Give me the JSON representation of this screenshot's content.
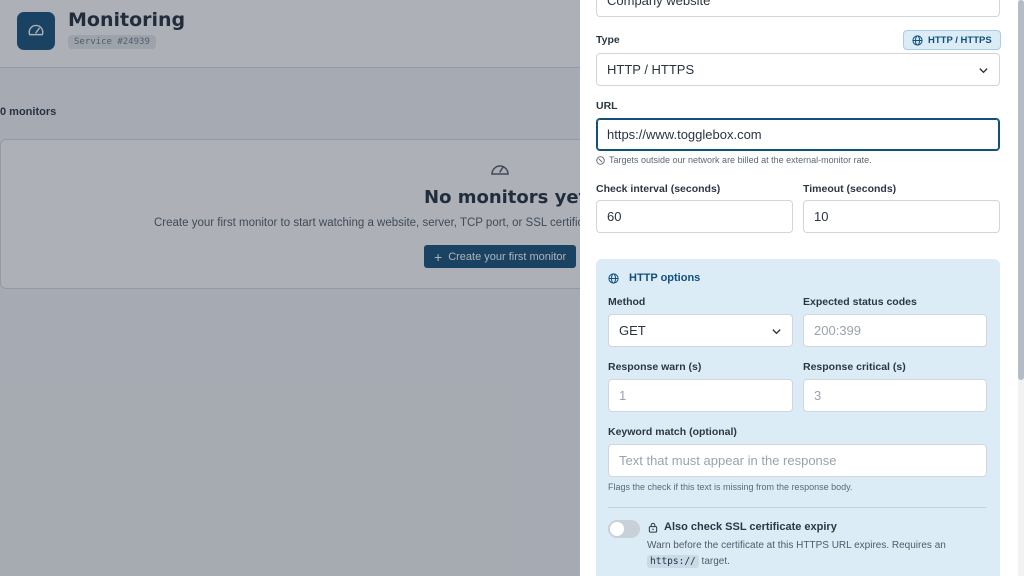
{
  "app": {
    "title": "Monitoring",
    "service_id": "Service #24939",
    "icon": "gauge-icon"
  },
  "list": {
    "count_label": "0 monitors",
    "empty_title": "No monitors yet",
    "empty_description": "Create your first monitor to start watching a website, server, TCP port, or SSL certificate.",
    "create_button": "Create your first monitor"
  },
  "drawer": {
    "name_value": "Company website",
    "type": {
      "label": "Type",
      "value": "HTTP / HTTPS",
      "pill": "HTTP / HTTPS"
    },
    "url": {
      "label": "URL",
      "value": "https://www.togglebox.com",
      "hint": "Targets outside our network are billed at the external-monitor rate."
    },
    "interval": {
      "label": "Check interval (seconds)",
      "value": "60"
    },
    "timeout": {
      "label": "Timeout (seconds)",
      "value": "10"
    },
    "http": {
      "title": "HTTP options",
      "method": {
        "label": "Method",
        "value": "GET"
      },
      "status_codes": {
        "label": "Expected status codes",
        "placeholder": "200:399"
      },
      "warn": {
        "label": "Response warn (s)",
        "placeholder": "1"
      },
      "critical": {
        "label": "Response critical (s)",
        "placeholder": "3"
      },
      "keyword": {
        "label": "Keyword match (optional)",
        "placeholder": "Text that must appear in the response",
        "hint": "Flags the check if this text is missing from the response body."
      },
      "ssl": {
        "title": "Also check SSL certificate expiry",
        "desc_before": "Warn before the certificate at this HTTPS URL expires. Requires an",
        "desc_code": "https://",
        "desc_after": "target.",
        "enabled": false
      }
    }
  },
  "colors": {
    "accent": "#12507a",
    "panel": "#dcecf6",
    "overlay": "rgba(40,48,62,0.38)"
  }
}
